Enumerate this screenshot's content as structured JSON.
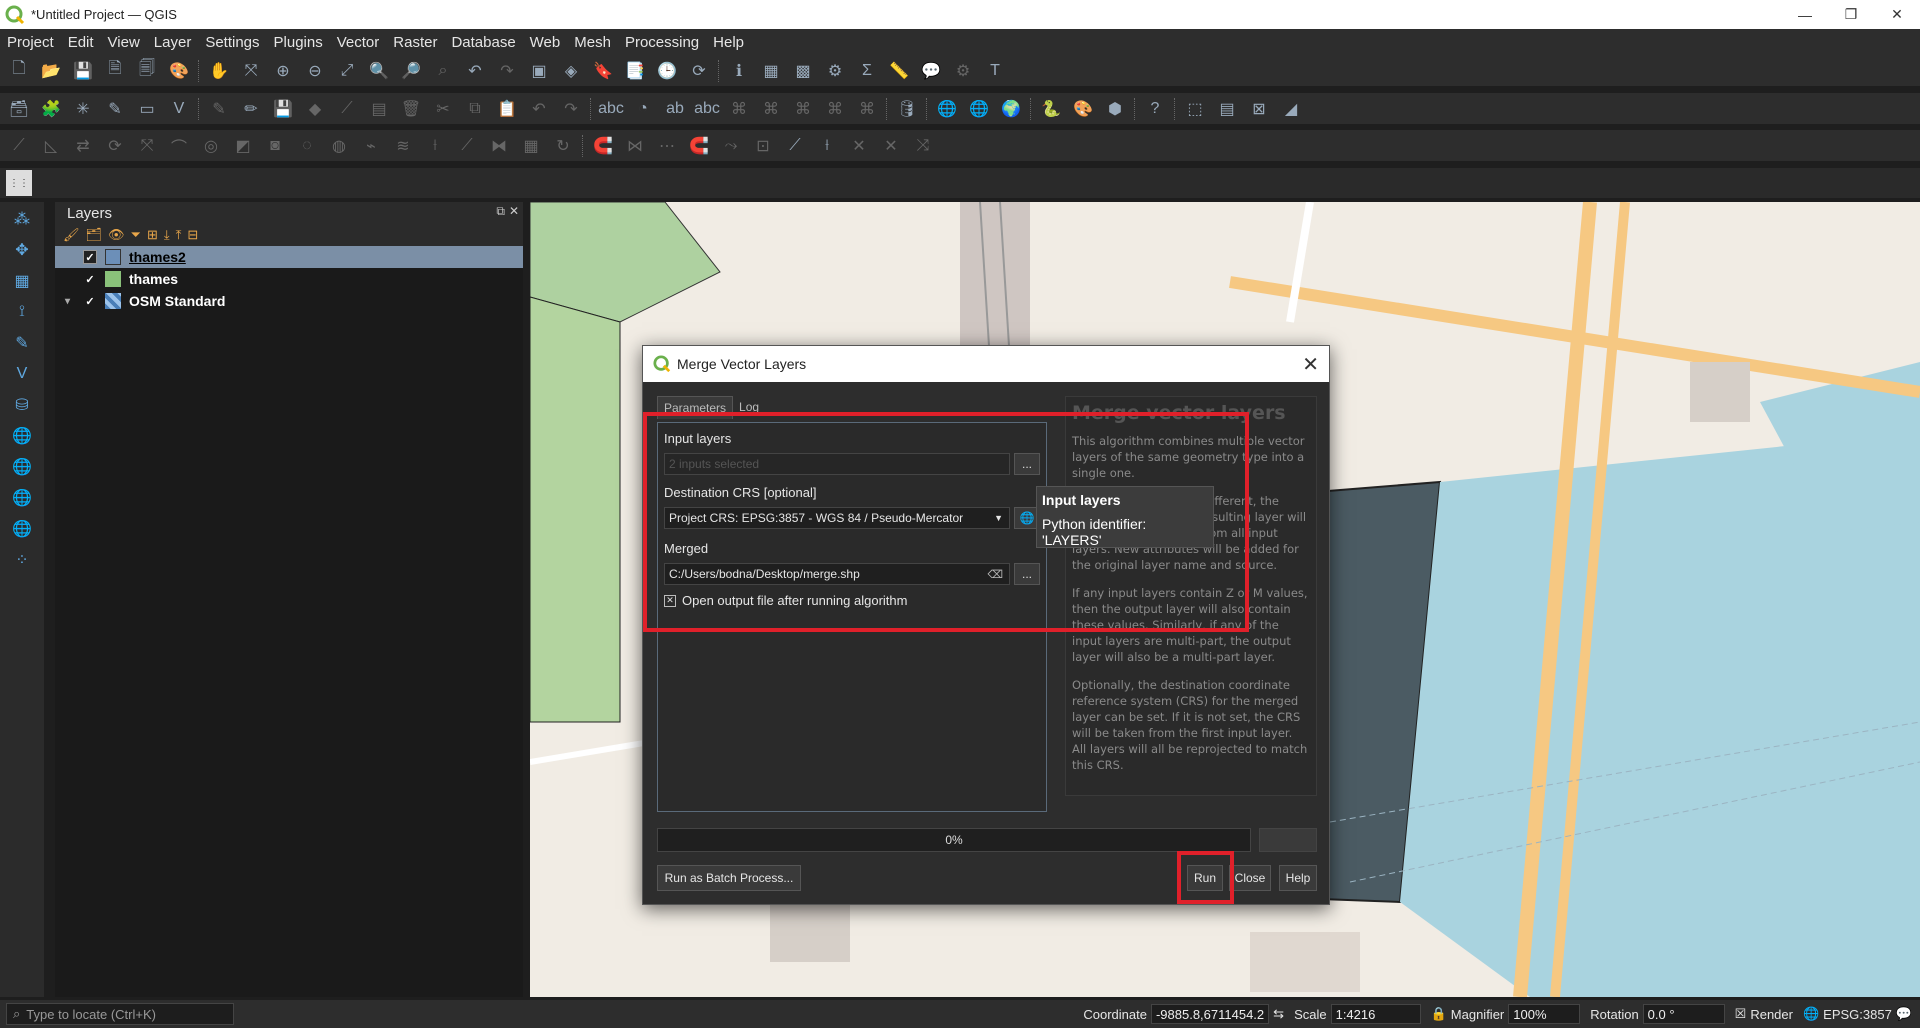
{
  "window": {
    "title": "*Untitled Project — QGIS"
  },
  "menu": [
    "Project",
    "Edit",
    "View",
    "Layer",
    "Settings",
    "Plugins",
    "Vector",
    "Raster",
    "Database",
    "Web",
    "Mesh",
    "Processing",
    "Help"
  ],
  "layers_panel": {
    "title": "Layers",
    "layers": [
      {
        "name": "thames2",
        "checked": true,
        "selected": true,
        "color": "#6c8fb8"
      },
      {
        "name": "thames",
        "checked": true,
        "selected": false,
        "color": "#8ac27a"
      },
      {
        "name": "OSM Standard",
        "checked": true,
        "selected": false,
        "color": "#4a7fb8"
      }
    ]
  },
  "dialog": {
    "title": "Merge Vector Layers",
    "tabs": [
      "Parameters",
      "Log"
    ],
    "input_layers_label": "Input layers",
    "input_layers_value": "2 inputs selected",
    "dest_crs_label": "Destination CRS [optional]",
    "dest_crs_value": "Project CRS: EPSG:3857 - WGS 84 / Pseudo-Mercator",
    "merged_label": "Merged",
    "merged_value": "C:/Users/bodna/Desktop/merge.shp",
    "open_output_label": "Open output file after running algorithm",
    "browse_label": "...",
    "progress": "0%",
    "batch_button": "Run as Batch Process...",
    "run_button": "Run",
    "close_button": "Close",
    "help_button": "Help",
    "help": {
      "title": "Merge vector layers",
      "p1": "This algorithm combines multiple vector layers of the same geometry type into a single one.",
      "p2": "If attributes tables are different, the attribute table for the resulting layer will contain the attributes from all input layers. New attributes will be added for the original layer name and source.",
      "p3": "If any input layers contain Z or M values, then the output layer will also contain these values. Similarly, if any of the input layers are multi-part, the output layer will also be a multi-part layer.",
      "p4": "Optionally, the destination coordinate reference system (CRS) for the merged layer can be set. If it is not set, the CRS will be taken from the first input layer. All layers will all be reprojected to match this CRS."
    }
  },
  "tooltip": {
    "title": "Input layers",
    "body": "Python identifier: 'LAYERS'"
  },
  "statusbar": {
    "locate_placeholder": "Type to locate (Ctrl+K)",
    "coordinate_label": "Coordinate",
    "coordinate_value": "-9885.8,6711454.2",
    "scale_label": "Scale",
    "scale_value": "1:4216",
    "magnifier_label": "Magnifier",
    "magnifier_value": "100%",
    "rotation_label": "Rotation",
    "rotation_value": "0.0 °",
    "render_label": "Render",
    "crs_label": "EPSG:3857"
  }
}
